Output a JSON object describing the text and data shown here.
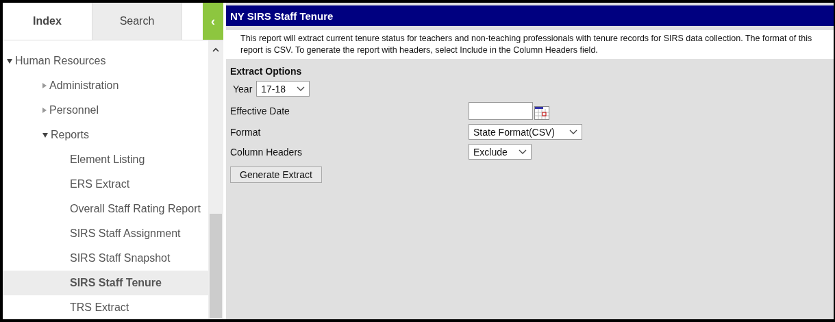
{
  "sidebar": {
    "tabs": [
      {
        "label": "Index",
        "selected": true
      },
      {
        "label": "Search",
        "selected": false
      }
    ],
    "collapse_button": "‹",
    "tree": [
      {
        "label": "Human Resources",
        "expanded": true,
        "selected": false,
        "children": [
          {
            "label": "Administration",
            "expanded": false,
            "selected": false
          },
          {
            "label": "Personnel",
            "expanded": false,
            "selected": false
          },
          {
            "label": "Reports",
            "expanded": true,
            "selected": false,
            "children": [
              {
                "label": "Element Listing",
                "selected": false
              },
              {
                "label": "ERS Extract",
                "selected": false
              },
              {
                "label": "Overall Staff Rating Report",
                "selected": false
              },
              {
                "label": "SIRS Staff Assignment",
                "selected": false
              },
              {
                "label": "SIRS Staff Snapshot",
                "selected": false
              },
              {
                "label": "SIRS Staff Tenure",
                "selected": true
              },
              {
                "label": "TRS Extract",
                "selected": false
              }
            ]
          }
        ]
      }
    ]
  },
  "main": {
    "title": "NY SIRS Staff Tenure",
    "description": "This report will extract current tenure status for teachers and non-teaching professionals with tenure records for SIRS data collection. The format of this report is CSV. To generate the report with headers, select Include in the Column Headers field.",
    "section_title": "Extract Options",
    "year": {
      "label": "Year",
      "value": "17-18"
    },
    "fields": [
      {
        "kind": "date",
        "label": "Effective Date"
      },
      {
        "kind": "select",
        "label": "Format",
        "value": "State Format(CSV)"
      },
      {
        "kind": "select",
        "label": "Column Headers",
        "value": "Exclude"
      }
    ],
    "button": "Generate Extract"
  }
}
